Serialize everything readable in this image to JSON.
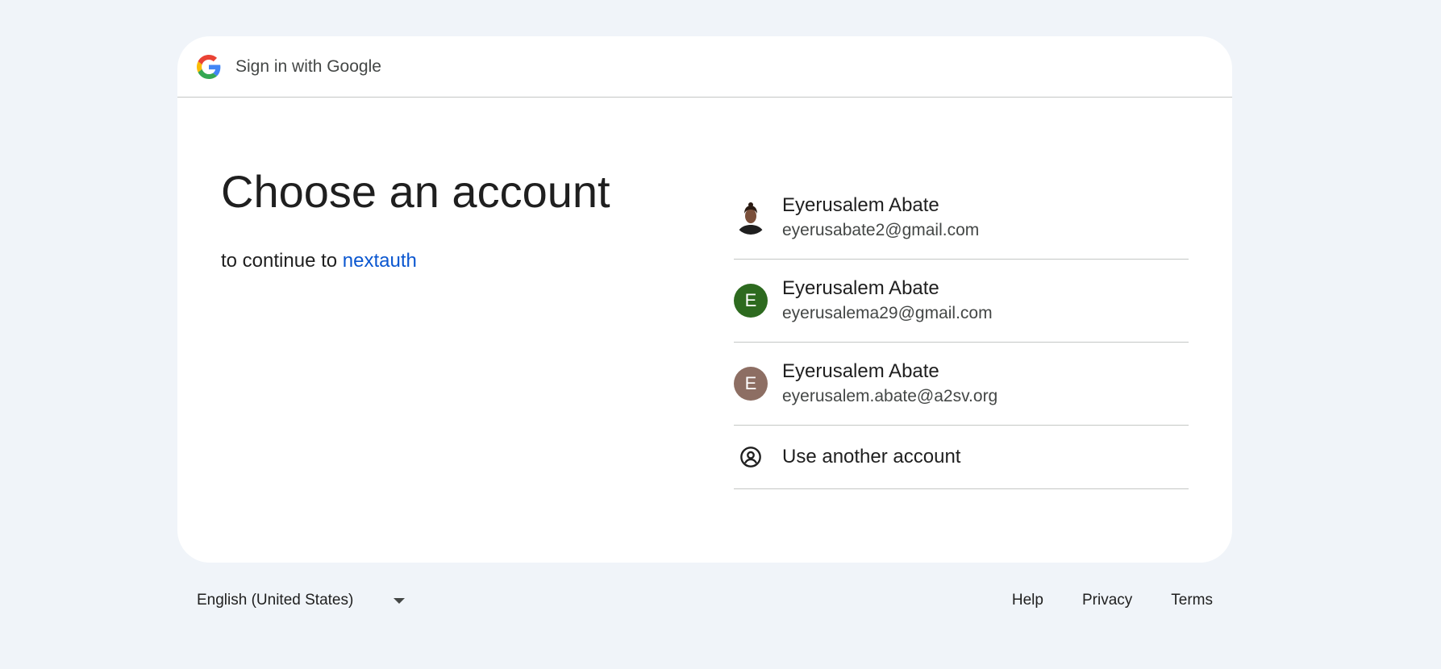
{
  "header": {
    "logo_icon": "google-g-icon",
    "title": "Sign in with Google"
  },
  "main": {
    "heading": "Choose an account",
    "subtext_prefix": "to continue to ",
    "app_name": "nextauth"
  },
  "accounts": [
    {
      "name": "Eyerusalem Abate",
      "email": "eyerusabate2@gmail.com",
      "avatar_type": "photo",
      "avatar_icon": "profile-photo"
    },
    {
      "name": "Eyerusalem Abate",
      "email": "eyerusalema29@gmail.com",
      "avatar_type": "letter",
      "avatar_letter": "E",
      "avatar_color": "#2d6a1f"
    },
    {
      "name": "Eyerusalem Abate",
      "email": "eyerusalem.abate@a2sv.org",
      "avatar_type": "letter",
      "avatar_letter": "E",
      "avatar_color": "#8d6e63"
    }
  ],
  "other_account": {
    "icon": "account-circle-icon",
    "label": "Use another account"
  },
  "footer": {
    "language": "English (United States)",
    "links": {
      "help": "Help",
      "privacy": "Privacy",
      "terms": "Terms"
    }
  },
  "colors": {
    "background": "#f0f4f9",
    "link": "#0b57d0"
  }
}
